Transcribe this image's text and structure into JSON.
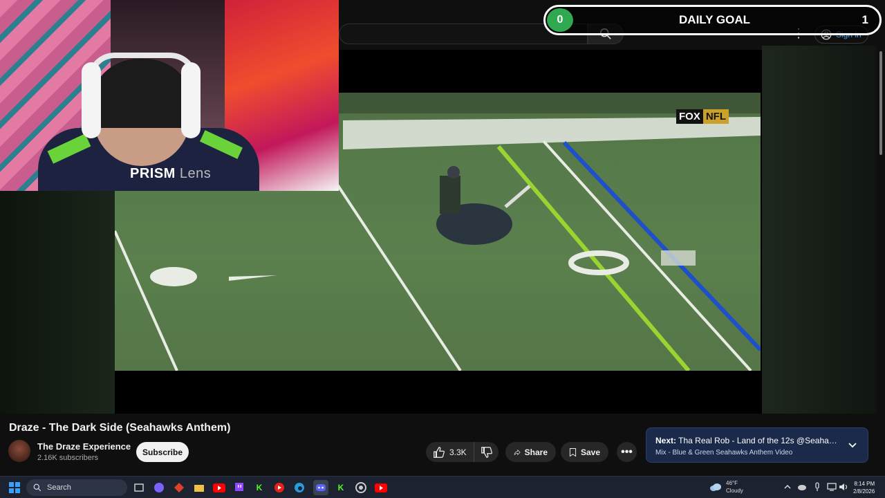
{
  "goal": {
    "label": "DAILY GOAL",
    "current": "0",
    "target": "1",
    "colors": {
      "badge": "#2fa84f"
    }
  },
  "webcam": {
    "brand_bold": "PRISM",
    "brand_light": " Lens"
  },
  "header": {
    "signin_label": "Sign in",
    "search_icon": "search-icon",
    "more_icon": "kebab-icon"
  },
  "video": {
    "broadcast_badge": {
      "fox": "FOX",
      "nfl": "NFL"
    },
    "title": "Draze - The Dark Side (Seahawks Anthem)",
    "channel": "The Draze Experience",
    "subscribers": "2.16K subscribers",
    "subscribe_label": "Subscribe",
    "likes": "3.3K",
    "share_label": "Share",
    "save_label": "Save"
  },
  "next_up": {
    "prefix": "Next:",
    "title": "Tha Real Rob - Land of the 12s @Seahawks A...",
    "subtitle": "Mix - Blue & Green Seahawks Anthem Video"
  },
  "taskbar": {
    "search_label": "Search",
    "weather_temp": "46°F",
    "weather_desc": "Cloudy",
    "time": "8:14 PM",
    "date": "2/8/2026"
  }
}
